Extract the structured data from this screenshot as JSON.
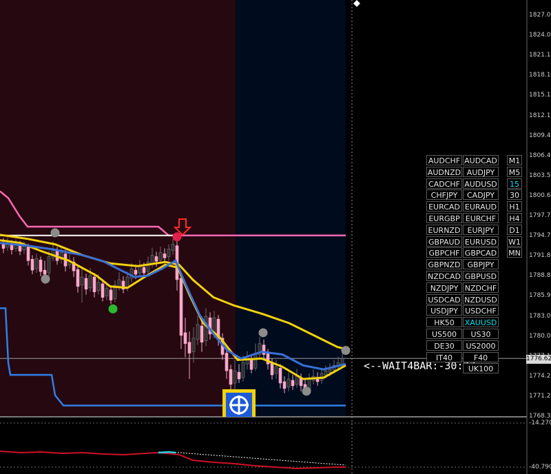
{
  "chart_data": {
    "type": "candlestick",
    "symbol_buttons": [
      [
        "AUDCHF",
        "AUDCAD"
      ],
      [
        "AUDNZD",
        "AUDJPY"
      ],
      [
        "CADCHF",
        "AUDUSD"
      ],
      [
        "CHFJPY",
        "CADJPY"
      ],
      [
        "EURCAD",
        "EURAUD"
      ],
      [
        "EURGBP",
        "EURCHF"
      ],
      [
        "EURNZD",
        "EURJPY"
      ],
      [
        "GBPAUD",
        "EURUSD"
      ],
      [
        "GBPCHF",
        "GBPCAD"
      ],
      [
        "GBPNZD",
        "GBPJPY"
      ],
      [
        "NZDCAD",
        "GBPUSD"
      ],
      [
        "NZDJPY",
        "NZDCHF"
      ],
      [
        "USDCAD",
        "NZDUSD"
      ],
      [
        "USDJPY",
        "USDCHF"
      ],
      [
        "HK50",
        "XAUUSD"
      ],
      [
        "US500",
        "US30"
      ],
      [
        "DE30",
        "US2000"
      ],
      [
        "IT40",
        "F40"
      ],
      [
        "",
        "UK100"
      ]
    ],
    "active_symbol": "XAUUSD",
    "timeframes": [
      "M1",
      "M5",
      "15",
      "30",
      "H1",
      "H4",
      "D1",
      "W1",
      "MN"
    ],
    "active_timeframe": "15",
    "price_axis_ticks": [
      "1827.00",
      "1824.00",
      "1821.15",
      "1818.15",
      "1815.15",
      "1812.15",
      "1809.40",
      "1806.40",
      "1803.55",
      "1800.60",
      "1797.70",
      "1794.70",
      "1791.85",
      "1788.85",
      "1785.90",
      "1783.00",
      "1780.05",
      "1777.10",
      "1774.25",
      "1771.25",
      "1768.30"
    ],
    "current_price": "1776.62",
    "status_label": "<--WAIT4BAR:-30:37",
    "indicator_axis_ticks": [
      "-14.2704",
      "-40.7902"
    ],
    "colors": {
      "session_asia_bg": "#260810",
      "session_ny_bg": "#000b1e",
      "yellow_band": "#f2d20e",
      "blue_line": "#3a6fd8",
      "pink_line": "#ff69b4",
      "signal_buy": "#2db82d",
      "signal_sell": "#e0204a",
      "bull_candle": "#1e1e1e",
      "bear_candle": "#f7a8c8",
      "indicator_red": "#d01028",
      "indicator_cyan": "#22d3e8"
    }
  }
}
